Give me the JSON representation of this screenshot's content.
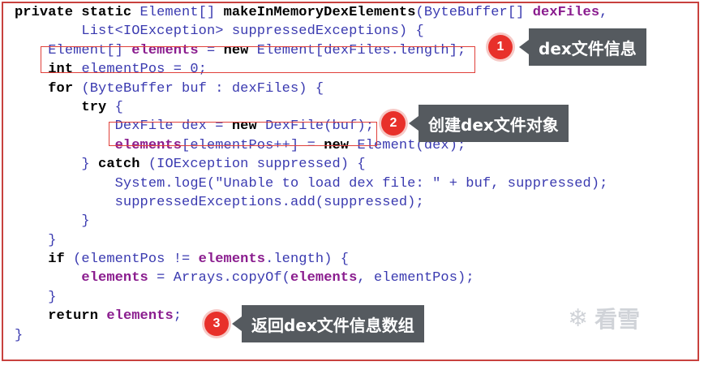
{
  "code_lines": [
    {
      "indent": "",
      "parts": [
        {
          "t": "private static ",
          "c": "kw"
        },
        {
          "t": "Element[] ",
          "c": "tx"
        },
        {
          "t": "makeInMemoryDexElements",
          "c": "fn"
        },
        {
          "t": "(ByteBuffer[] ",
          "c": "tx"
        },
        {
          "t": "dexFiles",
          "c": "pl"
        },
        {
          "t": ",",
          "c": "tx"
        }
      ]
    },
    {
      "indent": "        ",
      "parts": [
        {
          "t": "List<IOException> suppressedExceptions) {",
          "c": "tx"
        }
      ]
    },
    {
      "indent": "    ",
      "parts": [
        {
          "t": "Element[] ",
          "c": "tx"
        },
        {
          "t": "elements",
          "c": "pl"
        },
        {
          "t": " = ",
          "c": "tx"
        },
        {
          "t": "new ",
          "c": "kw"
        },
        {
          "t": "Element[dexFiles.length];",
          "c": "tx"
        }
      ]
    },
    {
      "indent": "    ",
      "parts": [
        {
          "t": "int ",
          "c": "kw"
        },
        {
          "t": "elementPos = 0;",
          "c": "tx"
        }
      ]
    },
    {
      "indent": "    ",
      "parts": [
        {
          "t": "for ",
          "c": "kw"
        },
        {
          "t": "(ByteBuffer buf : dexFiles) {",
          "c": "tx"
        }
      ]
    },
    {
      "indent": "        ",
      "parts": [
        {
          "t": "try ",
          "c": "kw"
        },
        {
          "t": "{",
          "c": "tx"
        }
      ]
    },
    {
      "indent": "            ",
      "parts": [
        {
          "t": "DexFile dex = ",
          "c": "tx"
        },
        {
          "t": "new ",
          "c": "kw"
        },
        {
          "t": "DexFile(buf);",
          "c": "tx"
        }
      ]
    },
    {
      "indent": "            ",
      "parts": [
        {
          "t": "elements",
          "c": "pl"
        },
        {
          "t": "[elementPos++] = ",
          "c": "tx"
        },
        {
          "t": "new ",
          "c": "kw"
        },
        {
          "t": "Element(dex);",
          "c": "tx"
        }
      ]
    },
    {
      "indent": "        ",
      "parts": [
        {
          "t": "} ",
          "c": "tx"
        },
        {
          "t": "catch ",
          "c": "kw"
        },
        {
          "t": "(IOException suppressed) {",
          "c": "tx"
        }
      ]
    },
    {
      "indent": "            ",
      "parts": [
        {
          "t": "System.logE(\"Unable to load dex file: \" + buf, suppressed);",
          "c": "tx"
        }
      ]
    },
    {
      "indent": "            ",
      "parts": [
        {
          "t": "suppressedExceptions.add(suppressed);",
          "c": "tx"
        }
      ]
    },
    {
      "indent": "        ",
      "parts": [
        {
          "t": "}",
          "c": "tx"
        }
      ]
    },
    {
      "indent": "    ",
      "parts": [
        {
          "t": "}",
          "c": "tx"
        }
      ]
    },
    {
      "indent": "    ",
      "parts": [
        {
          "t": "if ",
          "c": "kw"
        },
        {
          "t": "(elementPos != ",
          "c": "tx"
        },
        {
          "t": "elements",
          "c": "pl"
        },
        {
          "t": ".length) {",
          "c": "tx"
        }
      ]
    },
    {
      "indent": "        ",
      "parts": [
        {
          "t": "elements",
          "c": "pl"
        },
        {
          "t": " = Arrays.copyOf(",
          "c": "tx"
        },
        {
          "t": "elements",
          "c": "pl"
        },
        {
          "t": ", elementPos);",
          "c": "tx"
        }
      ]
    },
    {
      "indent": "    ",
      "parts": [
        {
          "t": "}",
          "c": "tx"
        }
      ]
    },
    {
      "indent": "    ",
      "parts": [
        {
          "t": "return ",
          "c": "kw"
        },
        {
          "t": "elements",
          "c": "pl"
        },
        {
          "t": ";",
          "c": "tx"
        }
      ]
    },
    {
      "indent": "",
      "parts": [
        {
          "t": "}",
          "c": "tx"
        }
      ]
    }
  ],
  "annotations": [
    {
      "number": "1",
      "label": "dex文件信息"
    },
    {
      "number": "2",
      "label": "创建dex文件对象"
    },
    {
      "number": "3",
      "label": "返回dex文件信息数组"
    }
  ],
  "watermark": {
    "icon": "snowflake-icon",
    "text": "看雪"
  },
  "colors": {
    "keyword": "#000000",
    "type_text": "#3a3ab0",
    "field": "#8a1c8e",
    "highlight": "#e0403a",
    "badge": "#e8302a",
    "callout": "#555a5f"
  }
}
